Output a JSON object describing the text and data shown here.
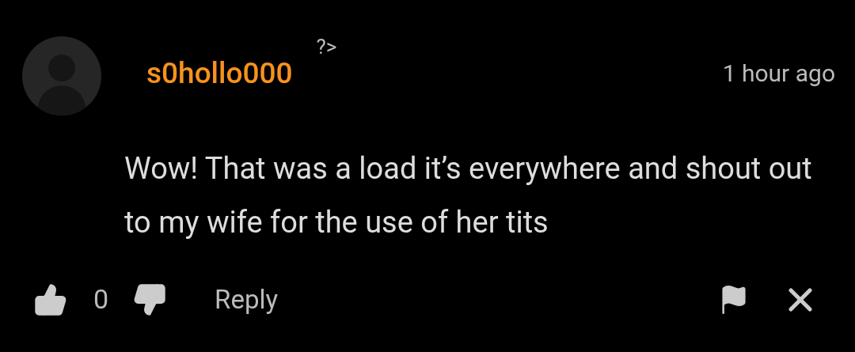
{
  "comment": {
    "username": "s0hollo000",
    "marker": "?>",
    "time": "1 hour ago",
    "text": "Wow! That was a load it’s everywhere and shout out to my wife for the use of her tits",
    "votes": "0",
    "reply": "Reply"
  }
}
